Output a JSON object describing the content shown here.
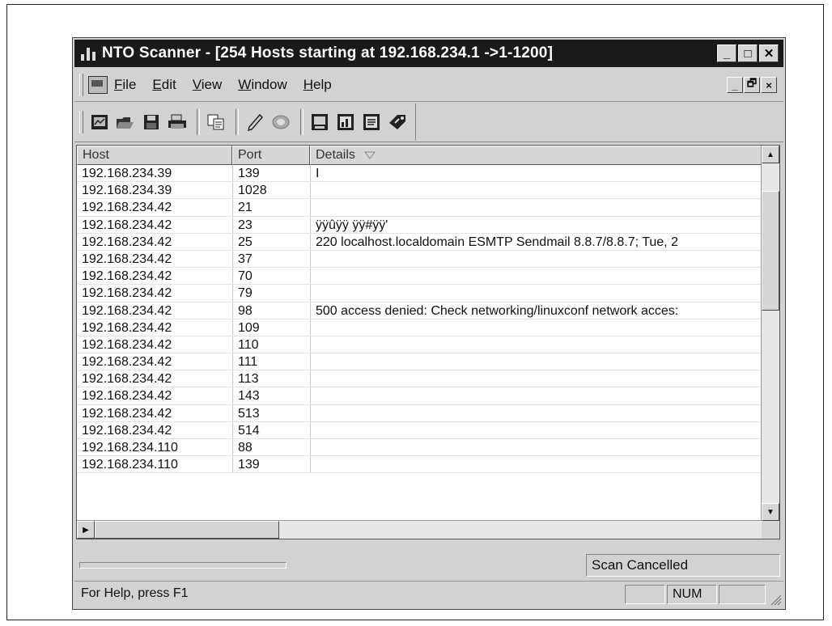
{
  "window": {
    "title": "NTO Scanner - [254 Hosts starting at 192.168.234.1 ->1-1200]",
    "buttons": {
      "minimize": "_",
      "maximize": "□",
      "close": "✕"
    }
  },
  "menu": {
    "items": [
      {
        "label": "File",
        "accel": "F",
        "rest": "ile"
      },
      {
        "label": "Edit",
        "accel": "E",
        "rest": "dit"
      },
      {
        "label": "View",
        "accel": "V",
        "rest": "iew"
      },
      {
        "label": "Window",
        "accel": "W",
        "rest": "indow"
      },
      {
        "label": "Help",
        "accel": "H",
        "rest": "elp"
      }
    ],
    "mdi": {
      "minimize": "_",
      "restore": "🗗",
      "close": "×"
    }
  },
  "toolbar": {
    "icons": [
      "new-scan-icon",
      "open-icon",
      "save-icon",
      "print-icon",
      "copy-icon",
      "pen-icon",
      "target-icon",
      "report-icon",
      "chart-icon",
      "document-icon",
      "tag-icon"
    ]
  },
  "table": {
    "columns": [
      "Host",
      "Port",
      "Details"
    ],
    "rows": [
      {
        "host": "192.168.234.39",
        "port": "139",
        "details": "I"
      },
      {
        "host": "192.168.234.39",
        "port": "1028",
        "details": ""
      },
      {
        "host": "192.168.234.42",
        "port": "21",
        "details": ""
      },
      {
        "host": "192.168.234.42",
        "port": "23",
        "details": "ÿÿûÿÿ ÿÿ#ÿÿ'"
      },
      {
        "host": "192.168.234.42",
        "port": "25",
        "details": "220 localhost.localdomain ESMTP Sendmail 8.8.7/8.8.7; Tue, 2"
      },
      {
        "host": "192.168.234.42",
        "port": "37",
        "details": ""
      },
      {
        "host": "192.168.234.42",
        "port": "70",
        "details": ""
      },
      {
        "host": "192.168.234.42",
        "port": "79",
        "details": ""
      },
      {
        "host": "192.168.234.42",
        "port": "98",
        "details": "500 access denied: Check networking/linuxconf network acces:"
      },
      {
        "host": "192.168.234.42",
        "port": "109",
        "details": ""
      },
      {
        "host": "192.168.234.42",
        "port": "110",
        "details": ""
      },
      {
        "host": "192.168.234.42",
        "port": "111",
        "details": ""
      },
      {
        "host": "192.168.234.42",
        "port": "113",
        "details": ""
      },
      {
        "host": "192.168.234.42",
        "port": "143",
        "details": ""
      },
      {
        "host": "192.168.234.42",
        "port": "513",
        "details": ""
      },
      {
        "host": "192.168.234.42",
        "port": "514",
        "details": ""
      },
      {
        "host": "192.168.234.110",
        "port": "88",
        "details": ""
      },
      {
        "host": "192.168.234.110",
        "port": "139",
        "details": ""
      }
    ]
  },
  "status": {
    "scan_state": "Scan Cancelled",
    "help": "For Help, press F1",
    "num": "NUM"
  }
}
